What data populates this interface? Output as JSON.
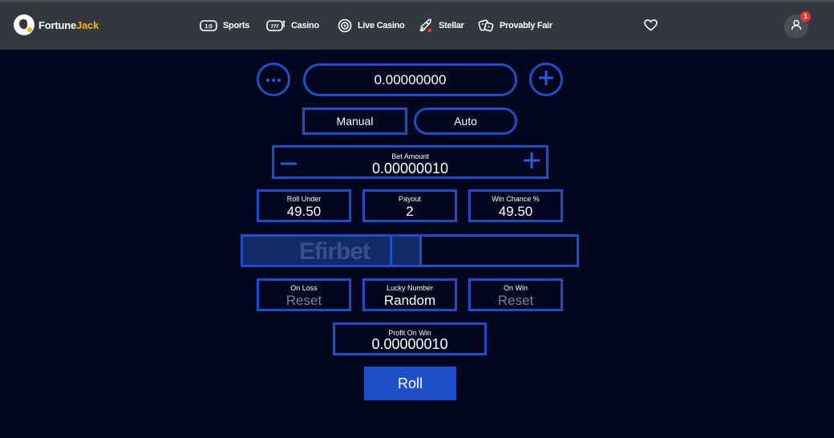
{
  "header": {
    "logo_text_white": "Fortune",
    "logo_text_yellow": "Jack",
    "nav": [
      {
        "label": "Sports",
        "icon": "scoreboard-icon"
      },
      {
        "label": "Casino",
        "icon": "slot-machine-icon"
      },
      {
        "label": "Live Casino",
        "icon": "live-target-icon"
      },
      {
        "label": "Stellar",
        "icon": "rocket-icon"
      },
      {
        "label": "Provably Fair",
        "icon": "dice-icon"
      }
    ],
    "notification_count": "1"
  },
  "game": {
    "balance": "0.00000000",
    "modes": {
      "manual": "Manual",
      "auto": "Auto"
    },
    "bet_amount": {
      "label": "Bet Amount",
      "value": "0.00000010"
    },
    "roll_under": {
      "label": "Roll Under",
      "value": "49.50"
    },
    "payout": {
      "label": "Payout",
      "value": "2"
    },
    "win_chance": {
      "label": "Win Chance %",
      "value": "49.50"
    },
    "slider": {
      "roll_under_fraction": 0.495,
      "watermark": "Efirbet"
    },
    "on_loss": {
      "label": "On Loss",
      "value": "Reset"
    },
    "lucky_number": {
      "label": "Lucky Number",
      "value": "Random"
    },
    "on_win": {
      "label": "On Win",
      "value": "Reset"
    },
    "profit_on_win": {
      "label": "Profit On Win",
      "value": "0.00000010"
    },
    "roll_label": "Roll"
  },
  "colors": {
    "background": "#02061f",
    "header": "#34373d",
    "accent_blue": "#1e4fc9",
    "brand_yellow": "#f5b400",
    "badge_red": "#e53935"
  }
}
